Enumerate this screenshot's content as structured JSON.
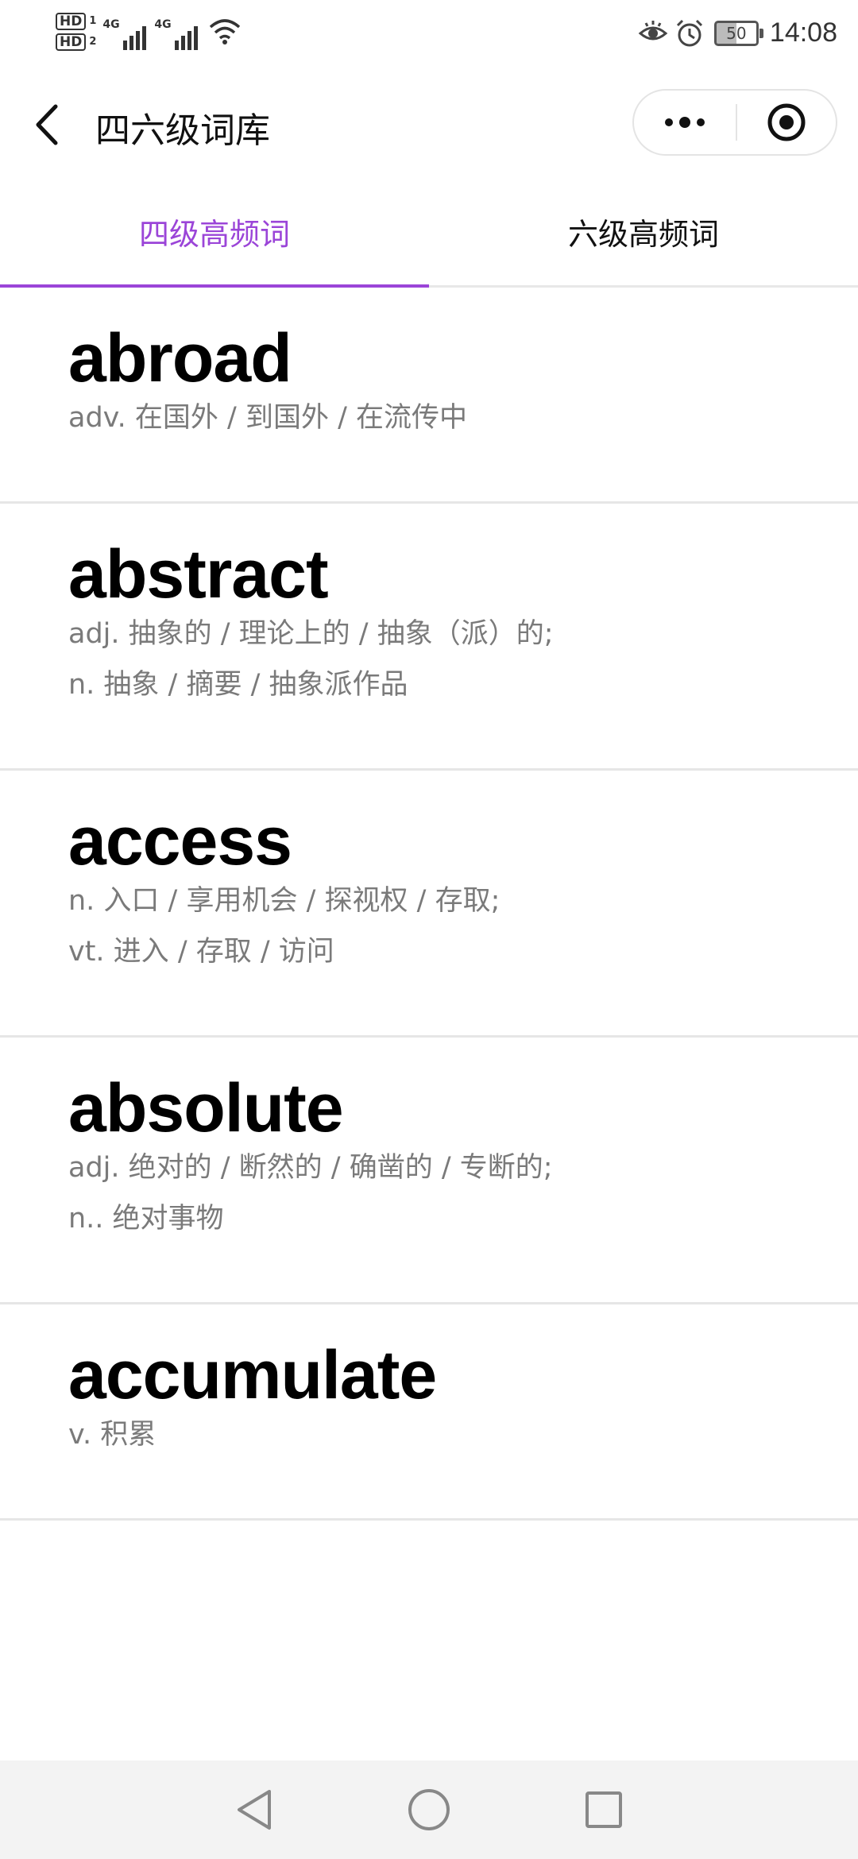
{
  "status_bar": {
    "hd1": "HD",
    "hd1_sim": "1",
    "hd2": "HD",
    "hd2_sim": "2",
    "net1": "4G",
    "net2": "4G",
    "battery": "50",
    "time": "14:08"
  },
  "nav": {
    "title": "四六级词库"
  },
  "tabs": [
    {
      "label": "四级高频词",
      "active": true
    },
    {
      "label": "六级高频词",
      "active": false
    }
  ],
  "words": [
    {
      "word": "abroad",
      "lines": [
        "adv. 在国外 / 到国外 / 在流传中"
      ]
    },
    {
      "word": "abstract",
      "lines": [
        "adj. 抽象的 / 理论上的 / 抽象（派）的;",
        "n. 抽象 / 摘要 / 抽象派作品"
      ]
    },
    {
      "word": "access",
      "lines": [
        "n. 入口 / 享用机会 / 探视权 / 存取;",
        "vt. 进入 / 存取 / 访问"
      ]
    },
    {
      "word": "absolute",
      "lines": [
        "adj. 绝对的 / 断然的 / 确凿的 / 专断的;",
        "n.. 绝对事物"
      ]
    },
    {
      "word": "accumulate",
      "lines": [
        "v. 积累"
      ]
    }
  ],
  "colors": {
    "accent": "#9b45d8",
    "meaning_text": "#7a7a7a",
    "divider": "#e6e6e6"
  },
  "icons": {
    "back": "chevron-left-icon",
    "more": "more-dots-icon",
    "target": "target-icon",
    "eye": "eye-icon",
    "alarm": "alarm-icon",
    "wifi": "wifi-icon",
    "nav_back": "triangle-back-icon",
    "nav_home": "circle-home-icon",
    "nav_recent": "square-recent-icon"
  }
}
